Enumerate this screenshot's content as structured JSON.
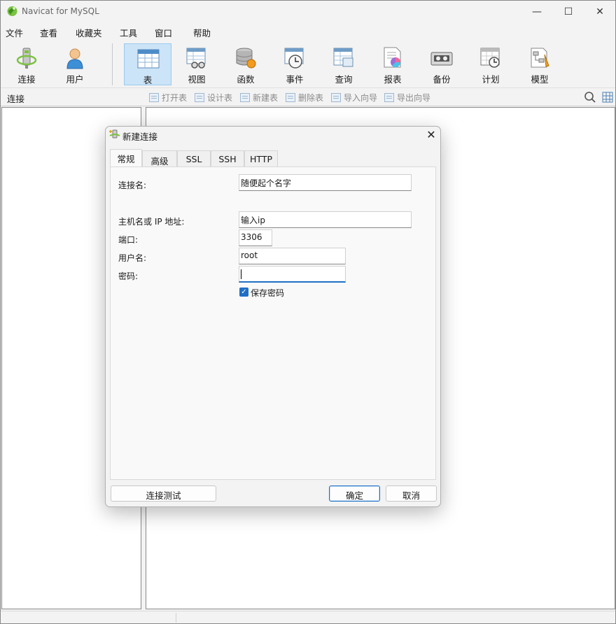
{
  "window": {
    "title": "Navicat for MySQL",
    "controls": {
      "minimize": "—",
      "maximize": "☐",
      "close": "✕"
    }
  },
  "menu": [
    "文件",
    "查看",
    "收藏夹",
    "工具",
    "窗口",
    "帮助"
  ],
  "toolbar": {
    "items": [
      {
        "label": "连接",
        "icon": "connection-icon"
      },
      {
        "label": "用户",
        "icon": "user-icon"
      },
      {
        "label": "表",
        "icon": "table-icon",
        "active": true
      },
      {
        "label": "视图",
        "icon": "view-icon"
      },
      {
        "label": "函数",
        "icon": "function-icon"
      },
      {
        "label": "事件",
        "icon": "event-icon"
      },
      {
        "label": "查询",
        "icon": "query-icon"
      },
      {
        "label": "报表",
        "icon": "report-icon"
      },
      {
        "label": "备份",
        "icon": "backup-icon"
      },
      {
        "label": "计划",
        "icon": "schedule-icon"
      },
      {
        "label": "模型",
        "icon": "model-icon"
      }
    ]
  },
  "subbar": {
    "title": "连接",
    "actions": [
      "打开表",
      "设计表",
      "新建表",
      "删除表",
      "导入向导",
      "导出向导"
    ]
  },
  "dialog": {
    "title": "新建连接",
    "close": "✕",
    "tabs": [
      "常规",
      "高级",
      "SSL",
      "SSH",
      "HTTP"
    ],
    "active_tab": "常规",
    "fields": {
      "connection_name_label": "连接名:",
      "connection_name_value": "随便起个名字",
      "host_label": "主机名或 IP 地址:",
      "host_value": "输入ip",
      "port_label": "端口:",
      "port_value": "3306",
      "username_label": "用户名:",
      "username_value": "root",
      "password_label": "密码:",
      "password_value": ""
    },
    "save_password": {
      "label": "保存密码",
      "checked": true,
      "mark": "✓"
    },
    "buttons": {
      "test": "连接测试",
      "ok": "确定",
      "cancel": "取消"
    }
  },
  "colors": {
    "accent": "#1f6fc5",
    "active_tab_bg": "#cce4f7"
  }
}
